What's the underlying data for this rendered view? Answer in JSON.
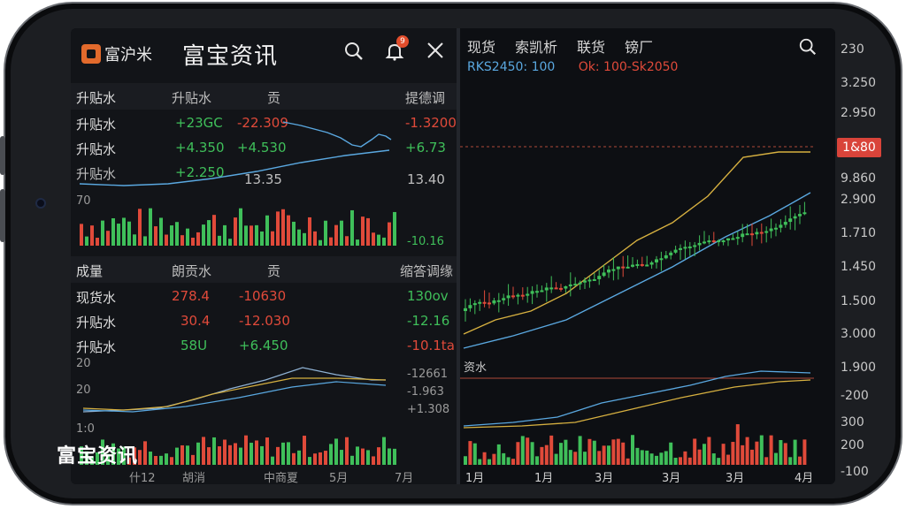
{
  "app": {
    "logo_text": "富沪米",
    "title": "富宝资讯",
    "watermark": "富宝资讯",
    "notification_count": "9"
  },
  "icons": {
    "search": "search-icon",
    "bell": "bell-icon",
    "close": "close-icon",
    "right_search": "search-icon"
  },
  "section1": {
    "headers": [
      "升贴水",
      "升贴水",
      "贡",
      "提德调"
    ],
    "rows": [
      {
        "name": "升贴水",
        "v1": "+23GC",
        "v2": "-22.309",
        "v3": "-1.3200"
      },
      {
        "name": "升贴水",
        "v1": "+4.350",
        "v2": "+4.530",
        "v3": "+6.73"
      },
      {
        "name": "升贴水",
        "v1": "+2.250",
        "v2": "",
        "v3": "13.40"
      }
    ],
    "side_values": [
      "13.35"
    ],
    "axis_left": "70",
    "axis_right": "-10.16"
  },
  "section2": {
    "headers": [
      "成量",
      "朗贡水",
      "贡",
      "缩答调缘"
    ],
    "rows": [
      {
        "name": "现货水",
        "v1": "278.4",
        "v2": "-10630",
        "v3": "130ov"
      },
      {
        "name": "升贴水",
        "v1": "30.4",
        "v2": "-12.030",
        "v3": "-12.16"
      },
      {
        "name": "升贴水",
        "v1": "58U",
        "v2": "+6.450",
        "v3": "-10.1ta"
      }
    ],
    "axis_left_top": "20",
    "axis_left_mid": "20",
    "axis_left_bot": "1:0",
    "right_vals": [
      "-12661",
      "-1.963",
      "+1.308"
    ],
    "x_labels": [
      "什12",
      "胡消",
      "中商夏",
      "5月",
      "7月"
    ]
  },
  "right": {
    "tabs": [
      "现货",
      "索凯析",
      "联货",
      "镑厂"
    ],
    "legend_blue": "RKS2450: 100",
    "legend_red": "Ok: 100-Sk2050",
    "price_tag": "1&80",
    "y_labels": [
      "230",
      "3.250",
      "2.950",
      "1&80",
      "9.860",
      "2.900",
      "1.710",
      "1.450",
      "1.500",
      "3.000",
      "1.900",
      "-200",
      "300",
      "200",
      "-100"
    ],
    "sub_label": "资水",
    "x_labels": [
      "1月",
      "1月",
      "3月",
      "3月",
      "3月",
      "4月"
    ]
  },
  "colors": {
    "up": "#e04a3a",
    "down": "#3fbf5a",
    "ma_blue": "#5aa8e0",
    "ma_yellow": "#d6b040",
    "background": "#0e1014"
  }
}
